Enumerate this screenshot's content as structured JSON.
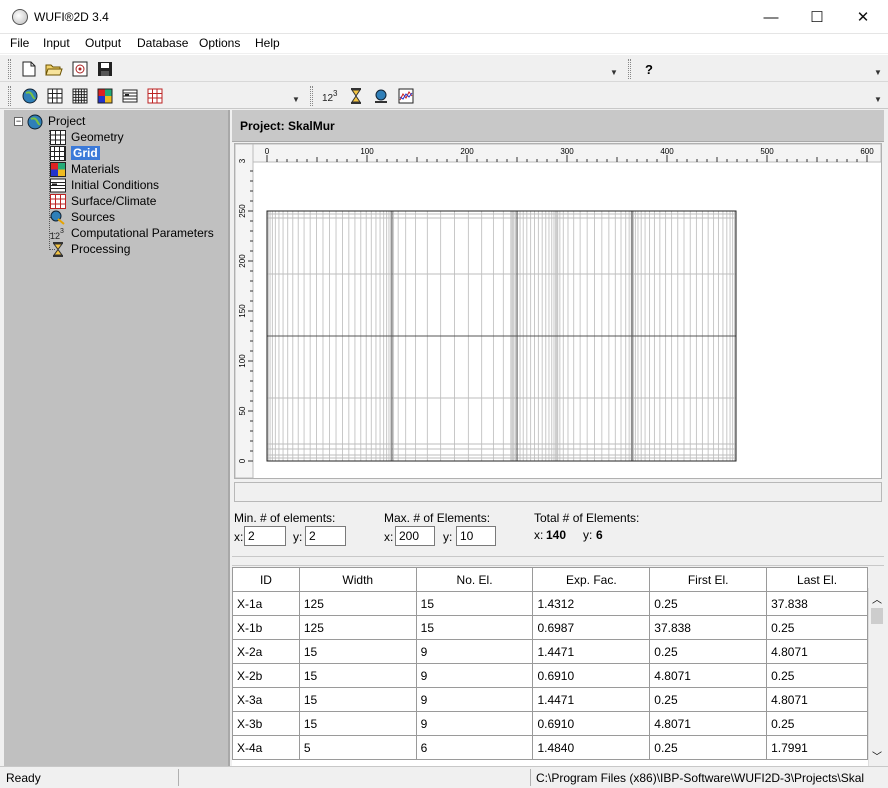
{
  "window": {
    "title": "WUFI®2D 3.4",
    "controls": {
      "minimize": "—",
      "maximize": "☐",
      "close": "✕"
    }
  },
  "menu": [
    "File",
    "Input",
    "Output",
    "Database",
    "Options",
    "Help"
  ],
  "toolbar1": {
    "icons": [
      "new-file-icon",
      "open-folder-icon",
      "settings-file-icon",
      "save-icon"
    ],
    "help": "?"
  },
  "toolbar2": {
    "icons": [
      "project-globe-icon",
      "geometry-grid-icon",
      "grid-icon",
      "materials-icon",
      "initial-conditions-icon",
      "surface-climate-icon"
    ],
    "icons_right": [
      "computational-parameters-icon",
      "hourglass-icon",
      "globe-calc-icon",
      "chart-icon"
    ]
  },
  "tree": {
    "root": "Project",
    "items": [
      "Geometry",
      "Grid",
      "Materials",
      "Initial Conditions",
      "Surface/Climate",
      "Sources",
      "Computational Parameters",
      "Processing"
    ],
    "selected": "Grid"
  },
  "project": {
    "title": "Project: SkalMur"
  },
  "plot": {
    "x_ticks": [
      "0",
      "100",
      "200",
      "300",
      "400",
      "500",
      "600"
    ],
    "y_ticks": [
      "0",
      "50",
      "100",
      "150",
      "200",
      "250",
      "3"
    ]
  },
  "elements": {
    "min_label": "Min. # of elements:",
    "max_label": "Max. # of Elements:",
    "total_label": "Total # of Elements:",
    "x_label": "x:",
    "y_label": "y:",
    "min_x": "2",
    "min_y": "2",
    "max_x": "200",
    "max_y": "10",
    "total_x": "140",
    "total_y": "6"
  },
  "table": {
    "headers": [
      "ID",
      "Width",
      "No. El.",
      "Exp. Fac.",
      "First El.",
      "Last El."
    ],
    "rows": [
      [
        "X-1a",
        "125",
        "15",
        "1.4312",
        "0.25",
        "37.838"
      ],
      [
        "X-1b",
        "125",
        "15",
        "0.6987",
        "37.838",
        "0.25"
      ],
      [
        "X-2a",
        "15",
        "9",
        "1.4471",
        "0.25",
        "4.8071"
      ],
      [
        "X-2b",
        "15",
        "9",
        "0.6910",
        "4.8071",
        "0.25"
      ],
      [
        "X-3a",
        "15",
        "9",
        "1.4471",
        "0.25",
        "4.8071"
      ],
      [
        "X-3b",
        "15",
        "9",
        "0.6910",
        "4.8071",
        "0.25"
      ],
      [
        "X-4a",
        "5",
        "6",
        "1.4840",
        "0.25",
        "1.7991"
      ]
    ]
  },
  "status": {
    "ready": "Ready",
    "path": "C:\\Program Files (x86)\\IBP-Software\\WUFI2D-3\\Projects\\Skal"
  }
}
